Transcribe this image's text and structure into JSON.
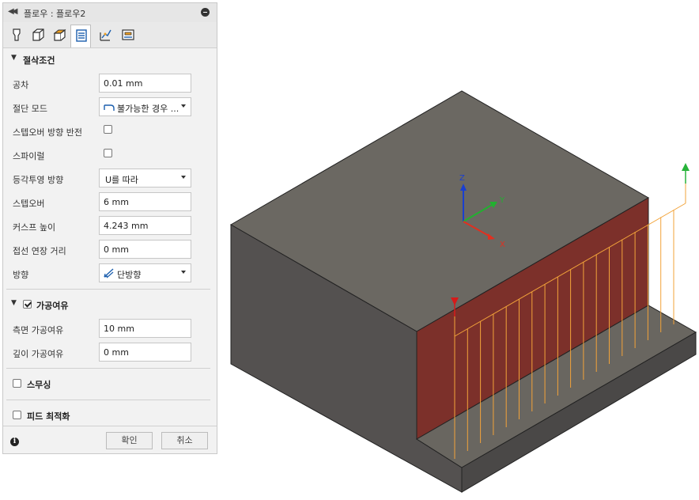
{
  "panel": {
    "title": "플로우 : 플로우2",
    "tabs": [
      {
        "name": "tool-tab",
        "icon": "tool-icon"
      },
      {
        "name": "geometry-tab",
        "icon": "geometry-icon"
      },
      {
        "name": "heights-tab",
        "icon": "heights-icon"
      },
      {
        "name": "passes-tab",
        "icon": "passes-icon",
        "active": true
      },
      {
        "name": "linking-tab",
        "icon": "linking-icon"
      },
      {
        "name": "post-tab",
        "icon": "post-icon"
      }
    ],
    "cutting": {
      "header": "절삭조건",
      "tolerance_label": "공차",
      "tolerance_value": "0.01 mm",
      "cut_mode_label": "절단 모드",
      "cut_mode_value": "불가능한 경우 ...",
      "reverse_stepover_label": "스텝오버 방향 반전",
      "reverse_stepover_checked": false,
      "spiral_label": "스파이럴",
      "spiral_checked": false,
      "iso_direction_label": "등각투영 방향",
      "iso_direction_value": "U를 따라",
      "stepover_label": "스텝오버",
      "stepover_value": "6 mm",
      "cusp_label": "커스프 높이",
      "cusp_value": "4.243 mm",
      "tangent_ext_label": "접선 연장 거리",
      "tangent_ext_value": "0 mm",
      "direction_label": "방향",
      "direction_value": "단방향"
    },
    "stock_to_leave": {
      "header": "가공여유",
      "checked": true,
      "radial_label": "측면 가공여유",
      "radial_value": "10 mm",
      "axial_label": "깊이 가공여유",
      "axial_value": "0 mm"
    },
    "smoothing": {
      "header": "스무싱",
      "checked": false
    },
    "feed_opt": {
      "header": "피드 최적화",
      "checked": false
    },
    "footer": {
      "ok_label": "확인",
      "cancel_label": "취소",
      "info_icon": "info-icon"
    }
  },
  "viewport": {
    "triad": {
      "x_label": "X",
      "y_label": "Y",
      "z_label": "Z"
    },
    "colors": {
      "body_top": "#6b6862",
      "body_side": "#545150",
      "selected_face": "#7c302a",
      "toolpath": "#f2a33a",
      "axis_x": "#e03020",
      "axis_y": "#22b030",
      "axis_z": "#1a3fd0"
    }
  }
}
